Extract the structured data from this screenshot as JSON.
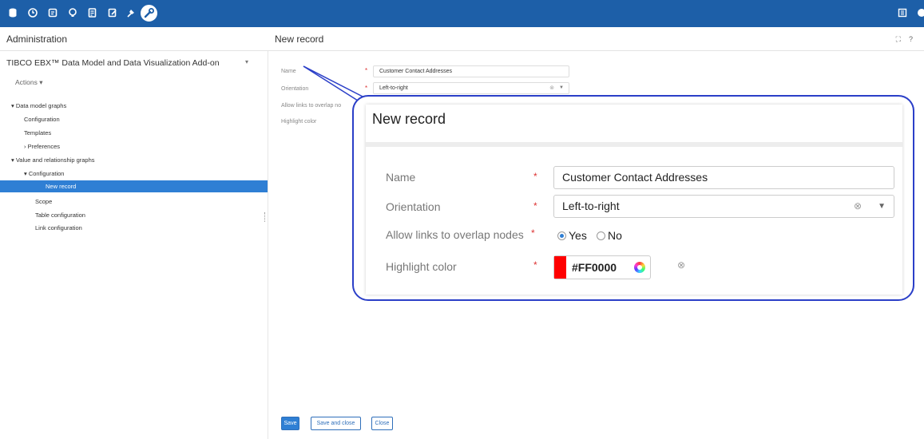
{
  "toolbar": {
    "icons": [
      "database-icon",
      "clock-icon",
      "document-icon",
      "bulb-icon",
      "data-icon",
      "edit-icon",
      "pin-icon",
      "wrench-icon"
    ],
    "right_icons": [
      "panel-icon",
      "settings-icon"
    ]
  },
  "left_panel": {
    "header": "Administration",
    "product": "TIBCO EBX™ Data Model and Data Visualization Add-on",
    "actions": "Actions ▾",
    "tree": [
      {
        "label": "▾ Data model graphs"
      },
      {
        "label": "Configuration"
      },
      {
        "label": "Templates"
      },
      {
        "label": "› Preferences"
      },
      {
        "label": "▾ Value and relationship graphs"
      },
      {
        "label": "▾ Configuration"
      },
      {
        "label": "New record",
        "selected": true
      },
      {
        "label": "Scope"
      },
      {
        "label": "Table configuration"
      },
      {
        "label": "Link configuration"
      }
    ]
  },
  "main": {
    "header": "New record",
    "form": {
      "name_label": "Name",
      "name_value": "Customer Contact Addresses",
      "orientation_label": "Orientation",
      "orientation_value": "Left-to-right",
      "overlap_label": "Allow links to overlap no",
      "highlight_label": "Highlight color",
      "required_mark": "*"
    },
    "buttons": {
      "save": "Save",
      "save_close": "Save and close",
      "close": "Close"
    }
  },
  "zoom": {
    "title": "New record",
    "name_label": "Name",
    "name_value": "Customer Contact Addresses",
    "orientation_label": "Orientation",
    "orientation_value": "Left-to-right",
    "overlap_label": "Allow links to overlap nodes",
    "overlap_yes": "Yes",
    "overlap_no": "No",
    "overlap_selected": "Yes",
    "highlight_label": "Highlight color",
    "highlight_value": "#FF0000",
    "required_mark": "*"
  },
  "colors": {
    "topbar": "#1d5fa8",
    "selection": "#2f7fd4",
    "callout": "#2b3fc8",
    "highlight": "#ff0000"
  }
}
